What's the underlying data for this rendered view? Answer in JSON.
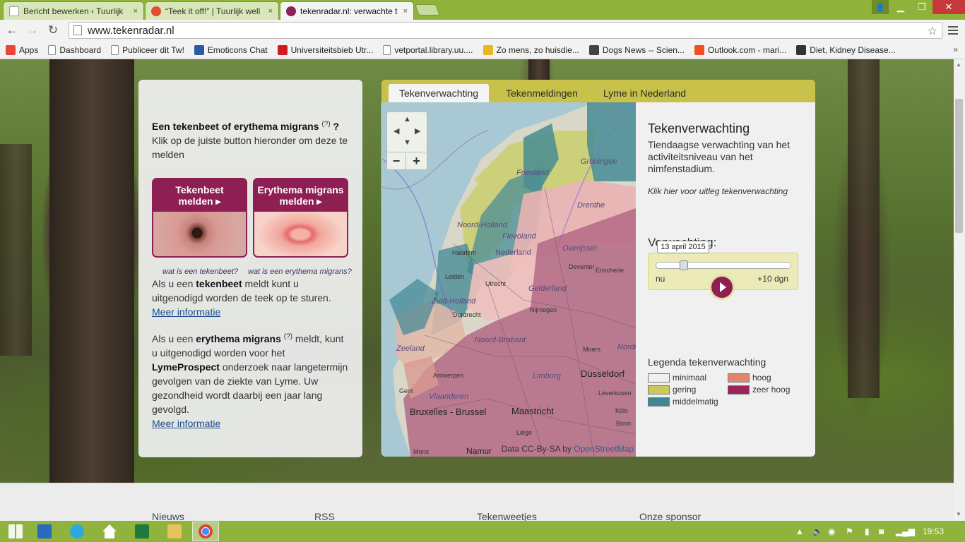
{
  "browser": {
    "tabs": [
      {
        "title": "Bericht bewerken ‹ Tuurlijk",
        "close": "×",
        "color": "#e8eef6"
      },
      {
        "title": "“Teek it off!” | Tuurlijk well",
        "close": "×",
        "color": "#e24c31"
      },
      {
        "title": "tekenradar.nl: verwachte t",
        "close": "×",
        "color": "#8e1f53"
      }
    ],
    "window_controls": {
      "minimize": "▁",
      "maximize": "❐",
      "close": "✕",
      "profile": "👤"
    },
    "url": "www.tekenradar.nl",
    "bookmarks": [
      {
        "label": "Apps",
        "icon": "apps-grid-icon",
        "color": "#e8453c"
      },
      {
        "label": "Dashboard",
        "icon": "page-icon",
        "color": ""
      },
      {
        "label": "Publiceer dit Tw!",
        "icon": "page-icon",
        "color": ""
      },
      {
        "label": "Emoticons Chat",
        "icon": "emoticon-icon",
        "color": "#2a5aa0"
      },
      {
        "label": "Universiteitsbieb Utr...",
        "icon": "library-icon",
        "color": "#d01c1c"
      },
      {
        "label": "vetportal.library.uu....",
        "icon": "page-icon",
        "color": ""
      },
      {
        "label": "Zo mens, zo huisdie...",
        "icon": "smiley-icon",
        "color": "#e7b81a"
      },
      {
        "label": "Dogs News -- Scien...",
        "icon": "sd-icon",
        "color": "#444444"
      },
      {
        "label": "Outlook.com - mari...",
        "icon": "outlook-icon",
        "color": "#f25022"
      },
      {
        "label": "Diet, Kidney Disease...",
        "icon": "cat-icon",
        "color": "#333333"
      }
    ],
    "bookmarks_more": "»"
  },
  "left_panel": {
    "question_bold": "Een tekenbeet of erythema migrans",
    "help_mark": "(?)",
    "question_end": " ?",
    "instruction": "Klik op de juiste button hieronder om deze te melden",
    "btn_tick_line1": "Tekenbeet",
    "btn_tick_line2": "melden ▸",
    "btn_em_line1": "Erythema migrans",
    "btn_em_line2": "melden ▸",
    "whatis_tick": "wat is een tekenbeet?",
    "whatis_em": "wat is een erythema migrans?",
    "para1_pre": "Als u een ",
    "para1_bold": "tekenbeet",
    "para1_post": " meldt kunt u uitgenodigd worden de teek op te sturen.",
    "more_info_1": "Meer informatie",
    "para2_pre": "Als u een ",
    "para2_bold": "erythema migrans",
    "para2_help": "(?)",
    "para2_mid": " meldt, kunt u uitgenodigd worden voor het ",
    "para2_bold2": "LymeProspect",
    "para2_post": " onderzoek naar langetermijn gevolgen van de ziekte van Lyme. Uw gezondheid wordt daarbij een jaar lang gevolgd.",
    "more_info_2": "Meer informatie"
  },
  "map_panel": {
    "tabs": [
      "Tekenverwachting",
      "Tekenmeldingen",
      "Lyme in Nederland"
    ],
    "map_labels": {
      "friesland": "Friesland",
      "groningen": "Groningen",
      "drenthe": "Drenthe",
      "noord_holland": "Noord-Holland",
      "flevoland": "Flevoland",
      "overijssel": "Overijssel",
      "haarlem": "Haarlem",
      "nederland": "Nederland",
      "deventer": "Deventer",
      "enschede": "Enschede",
      "leiden": "Leiden",
      "utrecht": "Utrecht",
      "gelderland": "Gelderland",
      "zuid_holland": "Zuid-Holland",
      "dordrecht": "Dordrecht",
      "nijmegen": "Nijmegen",
      "noord_brabant": "Noord-Brabant",
      "zeeland": "Zeeland",
      "moers": "Moers",
      "nordrhein": "Nordr",
      "antwerpen": "Antwerpen",
      "dusseldorf": "Düsseldorf",
      "limburg": "Limburg",
      "gent": "Gent",
      "vlaanderen": "Vlaanderen",
      "leverkusen": "Leverkusen",
      "koln": "Köln",
      "bruxelles": "Bruxelles - Brussel",
      "maastricht": "Maastricht",
      "liege": "Liège",
      "bonn": "Bonn",
      "mons": "Mons",
      "namur": "Namur"
    },
    "map_controls": {
      "up": "▲",
      "down": "▼",
      "left": "◀",
      "right": "▶",
      "zoom_out": "−",
      "zoom_in": "+"
    },
    "attribution_pre": "Data CC-By-SA by ",
    "attribution_link": "OpenStreetMap",
    "side_title": "Tekenverwachting",
    "side_subtitle": "Tiendaagse verwachting van het activiteitsniveau van het nimfenstadium.",
    "side_link": "Klik hier voor uitleg tekenverwachting",
    "forecast_label": "Verwachting:",
    "slider": {
      "date": "13 april 2015",
      "start": "nu",
      "end": "+10 dgn",
      "value_fraction": 0.19
    },
    "legend_title": "Legenda tekenverwachting",
    "legend": [
      {
        "label": "minimaal",
        "color": "#efefef"
      },
      {
        "label": "gering",
        "color": "#cbc95a"
      },
      {
        "label": "middelmatig",
        "color": "#3f8794"
      },
      {
        "label": "hoog",
        "color": "#e0856e"
      },
      {
        "label": "zeer hoog",
        "color": "#9b2458"
      }
    ]
  },
  "footer": {
    "links": [
      "Nieuws",
      "RSS",
      "Tekenweetjes",
      "Onze sponsor"
    ]
  },
  "taskbar": {
    "clock": "19:53"
  }
}
